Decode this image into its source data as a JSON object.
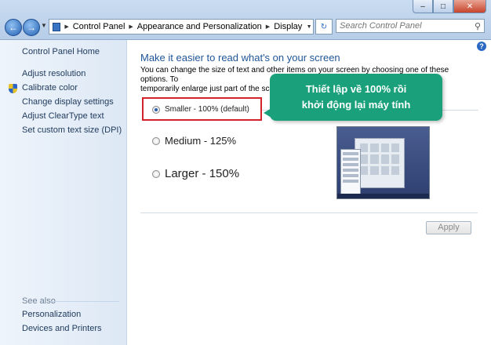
{
  "window": {
    "minimize_glyph": "–",
    "maximize_glyph": "□",
    "close_glyph": "✕"
  },
  "nav": {
    "back_glyph": "←",
    "forward_glyph": "→",
    "recent_glyph": "▼"
  },
  "address": {
    "segments": [
      "Control Panel",
      "Appearance and Personalization",
      "Display"
    ],
    "separator": "▶",
    "dropdown_glyph": "▼"
  },
  "refresh_glyph": "↻",
  "search": {
    "placeholder": "Search Control Panel",
    "icon_glyph": "⚲"
  },
  "sidebar": {
    "home": "Control Panel Home",
    "links": [
      "Adjust resolution",
      "Calibrate color",
      "Change display settings",
      "Adjust ClearType text",
      "Set custom text size (DPI)"
    ],
    "see_also_label": "See also",
    "see_also": [
      "Personalization",
      "Devices and Printers"
    ]
  },
  "main": {
    "help_glyph": "?",
    "heading": "Make it easier to read what's on your screen",
    "desc_line1": "You can change the size of text and other items on your screen by choosing one of these options. To",
    "desc_line2": "temporarily enlarge just part of the scree",
    "options": [
      {
        "label": "Smaller - 100% (default)",
        "selected": true
      },
      {
        "label": "Medium - 125%",
        "selected": false
      },
      {
        "label": "Larger - 150%",
        "selected": false
      }
    ],
    "apply": "Apply"
  },
  "callout": {
    "line1": "Thiết lập về 100% rồi",
    "line2": "khởi động lại máy tính",
    "color": "#1aa17b"
  },
  "colors": {
    "highlight_border": "#d2232a",
    "link": "#1e395b",
    "heading": "#1e5596"
  }
}
